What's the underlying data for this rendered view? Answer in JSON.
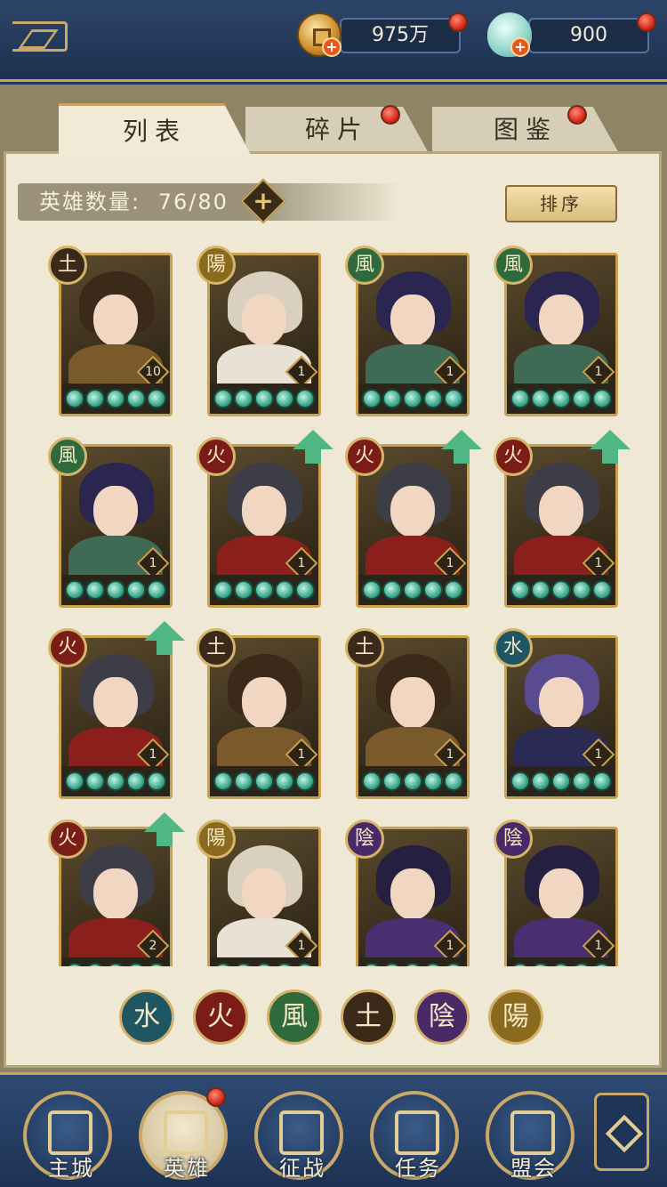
{
  "header": {
    "coins": "975万",
    "shells": "900"
  },
  "tabs": [
    {
      "label": "列表",
      "active": true
    },
    {
      "label": "碎片",
      "active": false
    },
    {
      "label": "图鉴",
      "active": false
    }
  ],
  "hero_count": {
    "label": "英雄数量:",
    "value": "76/80"
  },
  "sort_label": "排序",
  "heroes": [
    {
      "element": "土",
      "level": "10",
      "upgrade": false
    },
    {
      "element": "陽",
      "level": "1",
      "upgrade": false
    },
    {
      "element": "風",
      "level": "1",
      "upgrade": false
    },
    {
      "element": "風",
      "level": "1",
      "upgrade": false
    },
    {
      "element": "風",
      "level": "1",
      "upgrade": false
    },
    {
      "element": "火",
      "level": "1",
      "upgrade": true
    },
    {
      "element": "火",
      "level": "1",
      "upgrade": true
    },
    {
      "element": "火",
      "level": "1",
      "upgrade": true
    },
    {
      "element": "火",
      "level": "1",
      "upgrade": true
    },
    {
      "element": "土",
      "level": "1",
      "upgrade": false
    },
    {
      "element": "土",
      "level": "1",
      "upgrade": false
    },
    {
      "element": "水",
      "level": "1",
      "upgrade": false
    },
    {
      "element": "火",
      "level": "2",
      "upgrade": true
    },
    {
      "element": "陽",
      "level": "1",
      "upgrade": false
    },
    {
      "element": "陰",
      "level": "1",
      "upgrade": false
    },
    {
      "element": "陰",
      "level": "1",
      "upgrade": false
    }
  ],
  "filters": [
    "水",
    "火",
    "風",
    "土",
    "陰",
    "陽"
  ],
  "nav": [
    {
      "label": "主城",
      "active": false
    },
    {
      "label": "英雄",
      "active": true
    },
    {
      "label": "征战",
      "active": false
    },
    {
      "label": "任务",
      "active": false
    },
    {
      "label": "盟会",
      "active": false
    }
  ],
  "colors": {
    "fire": "#7a1d16",
    "water": "#1e5763",
    "wind": "#2f6a3d",
    "earth": "#3b2a1a",
    "yin": "#4a2a66",
    "yang": "#8a6a1c"
  }
}
